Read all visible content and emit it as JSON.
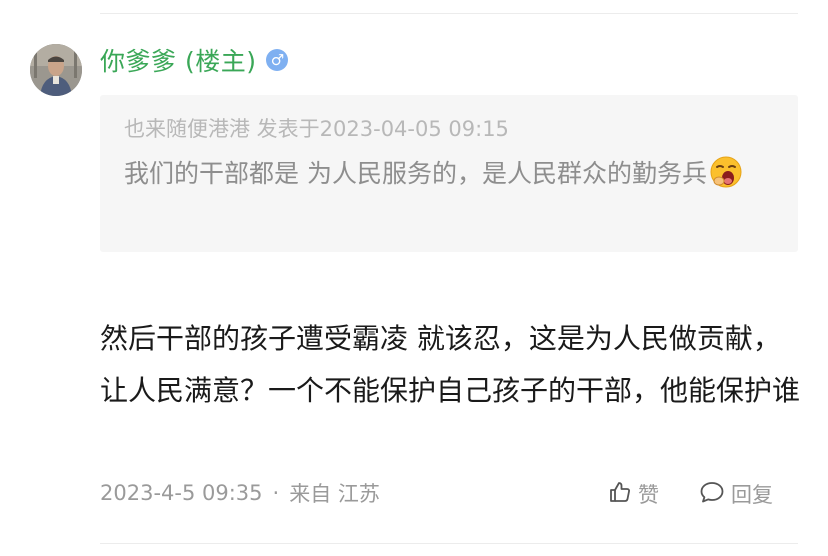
{
  "post": {
    "author": {
      "name": "你爹爹 (楼主)",
      "gender_symbol": "♂",
      "avatar_icon": "user-photo-avatar"
    },
    "quote": {
      "meta": "也来随便港港 发表于2023-04-05 09:15",
      "text": "我们的干部都是 为人民服务的，是人民群众的勤务兵",
      "emoji": "sleepy-yawning-face-emoji"
    },
    "reply_text": "然后干部的孩子遭受霸凌 就该忍，这是为人民做贡献，让人民满意？一个不能保护自己孩子的干部，他能保护谁",
    "meta": {
      "date": "2023-4-5 09:35",
      "separator": "·",
      "location": "来自 江苏"
    },
    "actions": {
      "like_label": "赞",
      "like_icon": "thumbs-up-icon",
      "reply_label": "回复",
      "reply_icon": "speech-bubble-icon"
    }
  },
  "colors": {
    "author_name": "#3aa757",
    "gender_badge": "#7fb0f1",
    "quote_background": "#f6f6f6",
    "meta_text": "#9a9a9a"
  }
}
